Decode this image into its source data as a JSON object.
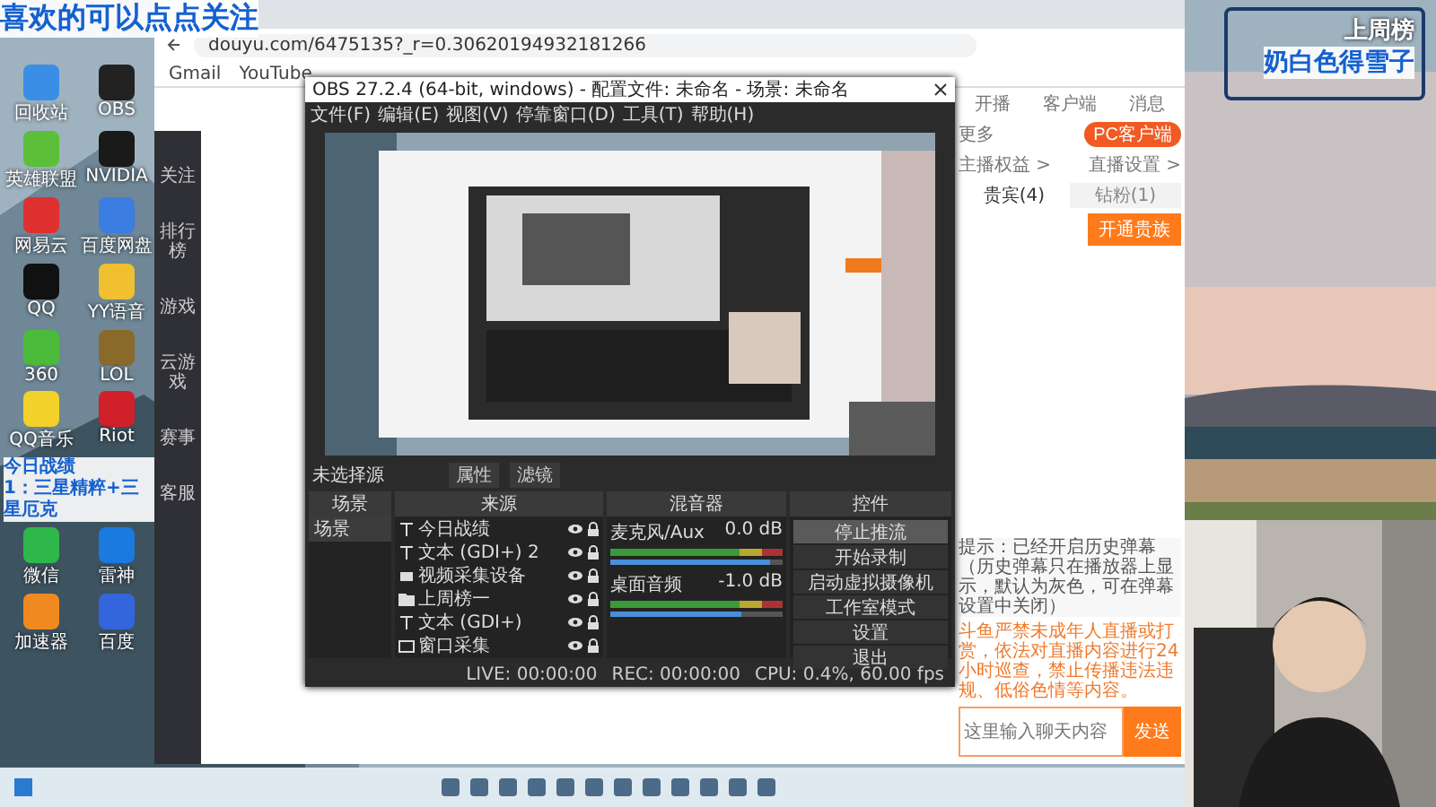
{
  "overlays": {
    "follow_banner": "喜欢的可以点点关注",
    "weekly_rank_label": "上周榜",
    "weekly_rank_name": "奶白色得雪子",
    "record_title": "今日战绩",
    "record_line": "1：三星精粹+三星厄克"
  },
  "desktop_icons": [
    {
      "label": "回收站",
      "color": "#3a8ee6"
    },
    {
      "label": "OBS",
      "color": "#222222"
    },
    {
      "label": "英雄联盟",
      "color": "#5cbf3a"
    },
    {
      "label": "NVIDIA",
      "color": "#1a1a1a"
    },
    {
      "label": "网易云",
      "color": "#e03030"
    },
    {
      "label": "百度网盘",
      "color": "#3b7de0"
    },
    {
      "label": "QQ",
      "color": "#111111"
    },
    {
      "label": "YY语音",
      "color": "#f0c030"
    },
    {
      "label": "360",
      "color": "#4cbb3c"
    },
    {
      "label": "LOL",
      "color": "#8a6a2a"
    },
    {
      "label": "QQ音乐",
      "color": "#f2d22a"
    },
    {
      "label": "Riot",
      "color": "#d0202a"
    },
    {
      "label": "微信",
      "color": "#2fb84a"
    },
    {
      "label": "雷神",
      "color": "#1a7ae0"
    },
    {
      "label": "加速器",
      "color": "#f08a20"
    },
    {
      "label": "百度",
      "color": "#3366dd"
    }
  ],
  "browser": {
    "url": "douyu.com/6475135?_r=0.30620194932181266",
    "bookmarks": [
      "Gmail",
      "YouTube"
    ]
  },
  "site_sidebar": [
    "关注",
    "排行榜",
    "游戏",
    "云游戏",
    "赛事",
    "客服"
  ],
  "obs": {
    "title": "OBS 27.2.4 (64-bit, windows) - 配置文件: 未命名 - 场景: 未命名",
    "menu": [
      "文件(F)",
      "编辑(E)",
      "视图(V)",
      "停靠窗口(D)",
      "工具(T)",
      "帮助(H)"
    ],
    "no_source": "未选择源",
    "properties": "属性",
    "filters": "滤镜",
    "docks": [
      "场景",
      "来源",
      "混音器",
      "控件"
    ],
    "scenes": [
      {
        "name": "场景",
        "selected": true
      }
    ],
    "sources": [
      {
        "kind": "text",
        "name": "今日战绩"
      },
      {
        "kind": "text",
        "name": "文本 (GDI+) 2"
      },
      {
        "kind": "camera",
        "name": "视频采集设备"
      },
      {
        "kind": "folder",
        "name": "上周榜一"
      },
      {
        "kind": "text",
        "name": "文本 (GDI+)"
      },
      {
        "kind": "window",
        "name": "窗口采集"
      }
    ],
    "mixer": [
      {
        "name": "麦克风/Aux",
        "reading": "0.0 dB",
        "level": 0.93
      },
      {
        "name": "桌面音频",
        "reading": "-1.0 dB",
        "level": 0.76
      }
    ],
    "controls": [
      {
        "label": "停止推流",
        "selected": true
      },
      {
        "label": "开始录制",
        "selected": false
      },
      {
        "label": "启动虚拟摄像机",
        "selected": false
      },
      {
        "label": "工作室模式",
        "selected": false
      },
      {
        "label": "设置",
        "selected": false
      },
      {
        "label": "退出",
        "selected": false
      }
    ],
    "status": [
      "LIVE: 00:00:00",
      "REC: 00:00:00",
      "CPU: 0.4%, 60.00 fps"
    ]
  },
  "site_panel": {
    "top_items": [
      "开播",
      "客户端",
      "消息"
    ],
    "more": "更多",
    "pc_client": "PC客户端",
    "links": [
      "主播权益 >",
      "直播设置 >"
    ],
    "tabs": [
      {
        "label": "贵宾(4)",
        "selected": true
      },
      {
        "label": "钻粉(1)",
        "selected": false
      }
    ],
    "open_noble": "开通贵族",
    "notice": "提示：已经开启历史弹幕（历史弹幕只在播放器上显示，默认为灰色，可在弹幕设置中关闭）",
    "rules": "斗鱼严禁未成年人直播或打赏，依法对直播内容进行24小时巡查，禁止传播违法违规、低俗色情等内容。",
    "chat_placeholder": "这里输入聊天内容",
    "send": "发送"
  }
}
